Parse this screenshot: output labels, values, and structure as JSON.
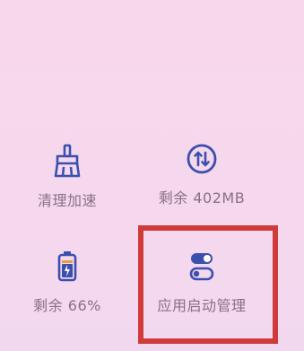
{
  "tiles": [
    {
      "name": "cleanup",
      "label": "清理加速",
      "icon": "broom-icon"
    },
    {
      "name": "memory",
      "label": "剩余 402MB",
      "icon": "memory-arrows-icon"
    },
    {
      "name": "battery",
      "label": "剩余 66%",
      "icon": "battery-icon"
    },
    {
      "name": "startup",
      "label": "应用启动管理",
      "icon": "toggle-switch-icon"
    }
  ],
  "colors": {
    "background_top": "#f8d7ea",
    "icon_blue": "#3b4fae",
    "label_text": "#8a6f86",
    "highlight_red": "#cf3a3a"
  }
}
